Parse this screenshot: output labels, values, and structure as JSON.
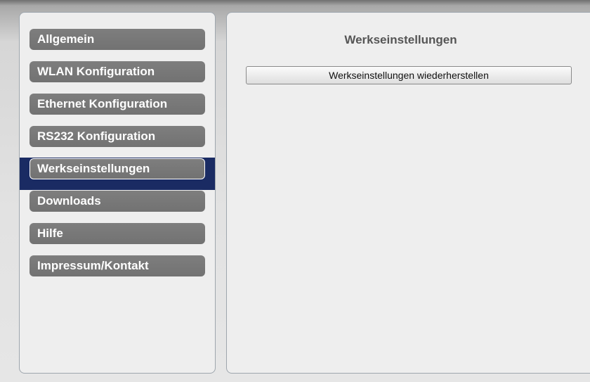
{
  "sidebar": {
    "items": [
      {
        "label": "Allgemein",
        "active": false
      },
      {
        "label": "WLAN Konfiguration",
        "active": false
      },
      {
        "label": "Ethernet Konfiguration",
        "active": false
      },
      {
        "label": "RS232 Konfiguration",
        "active": false
      },
      {
        "label": "Werkseinstellungen",
        "active": true
      },
      {
        "label": "Downloads",
        "active": false
      },
      {
        "label": "Hilfe",
        "active": false
      },
      {
        "label": "Impressum/Kontakt",
        "active": false
      }
    ]
  },
  "main": {
    "title": "Werkseinstellungen",
    "reset_button_label": "Werkseinstellungen wiederherstellen"
  },
  "colors": {
    "nav_button": "#777777",
    "active_highlight": "#1a2b63",
    "panel_background": "#eeeeee",
    "title_text": "#555555"
  }
}
